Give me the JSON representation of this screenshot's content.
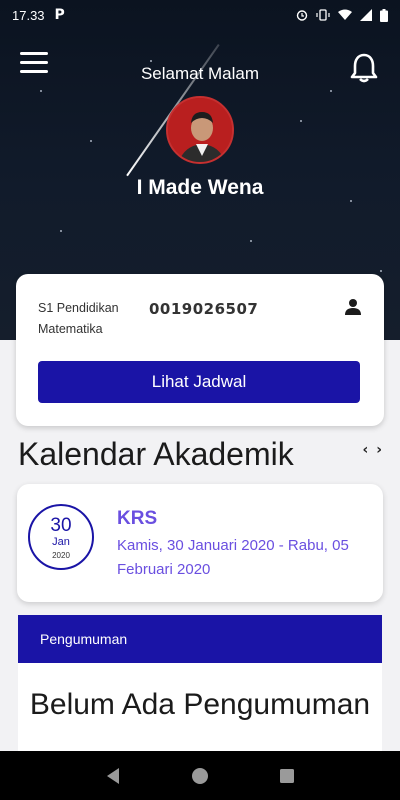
{
  "status_bar": {
    "time": "17.33",
    "app_indicator": "P",
    "icons": [
      "alarm-icon",
      "vibrate-icon",
      "wifi-icon",
      "signal-icon",
      "battery-icon"
    ]
  },
  "header": {
    "greeting": "Selamat Malam",
    "user_name": "I Made Wena",
    "menu_icon": "hamburger-icon",
    "notification_icon": "bell-icon"
  },
  "profile": {
    "program": "S1 Pendidikan Matematika",
    "id_number": "0019026507",
    "schedule_button": "Lihat Jadwal"
  },
  "calendar": {
    "title": "Kalendar Akademik",
    "prev": "‹",
    "next": "›",
    "event": {
      "day": "30",
      "month": "Jan",
      "year": "2020",
      "title": "KRS",
      "date_range": "Kamis, 30 Januari 2020 - Rabu, 05 Februari 2020"
    }
  },
  "announcements": {
    "header": "Pengumuman",
    "empty_message": "Belum Ada Pengumuman"
  },
  "colors": {
    "primary": "#1a14a6",
    "accent": "#6a4fe0",
    "hero": "#111b2b"
  }
}
